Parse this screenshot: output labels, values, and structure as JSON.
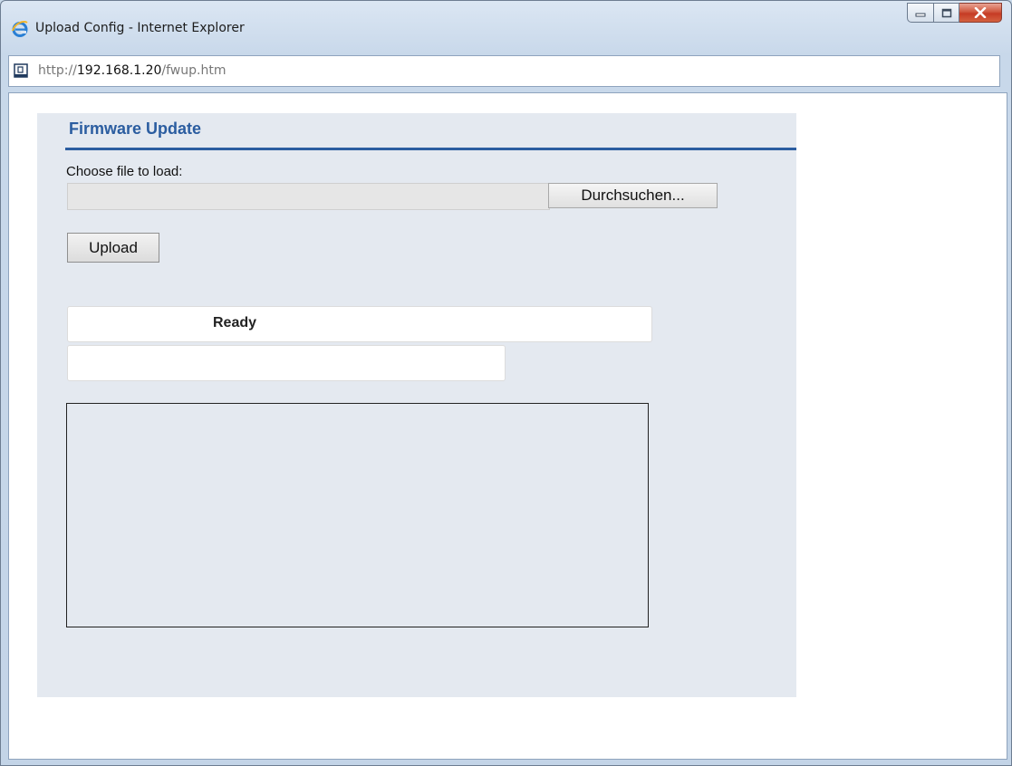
{
  "window": {
    "title": "Upload Config - Internet Explorer",
    "icon": "ie-icon",
    "buttons": [
      "minimize-icon",
      "maximize-icon",
      "close-icon"
    ]
  },
  "address_bar": {
    "url_prefix": "http://",
    "url_host": "192.168.1.20",
    "url_path": "/fwup.htm",
    "icon": "page-icon"
  },
  "page": {
    "title": "Firmware Update",
    "choose_label": "Choose file to load:",
    "file_input_value": "",
    "browse_label": "Durchsuchen...",
    "upload_label": "Upload",
    "status_text": "Ready",
    "progress_text": "",
    "log_text": ""
  },
  "colors": {
    "accent": "#2b5da0",
    "panel_bg": "#e4e9f0",
    "close_button": "#c63b25"
  }
}
